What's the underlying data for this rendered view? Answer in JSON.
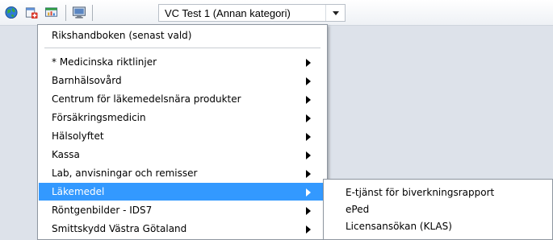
{
  "toolbar": {
    "icons": [
      "globe-icon",
      "document-add-icon",
      "chart-window-icon",
      "monitor-icon"
    ],
    "context_selector": {
      "value": "VC Test 1 (Annan kategori)"
    }
  },
  "menu": {
    "top_item": {
      "label": "Rikshandboken  (senast vald)"
    },
    "items": [
      {
        "label": "* Medicinska riktlinjer",
        "has_submenu": true
      },
      {
        "label": "Barnhälsovård",
        "has_submenu": true
      },
      {
        "label": "Centrum för läkemedelsnära produkter",
        "has_submenu": true
      },
      {
        "label": "Försäkringsmedicin",
        "has_submenu": true
      },
      {
        "label": "Hälsolyftet",
        "has_submenu": true
      },
      {
        "label": "Kassa",
        "has_submenu": true
      },
      {
        "label": "Lab, anvisningar och remisser",
        "has_submenu": true
      },
      {
        "label": "Läkemedel",
        "has_submenu": true,
        "selected": true
      },
      {
        "label": "Röntgenbilder - IDS7",
        "has_submenu": true
      },
      {
        "label": "Smittskydd Västra Götaland",
        "has_submenu": true
      }
    ]
  },
  "submenu": {
    "items": [
      {
        "label": "E-tjänst för biverkningsrapport"
      },
      {
        "label": "ePed"
      },
      {
        "label": "Licensansökan (KLAS)"
      }
    ]
  },
  "colors": {
    "selection": "#3399ff",
    "menu_background": "#ffffff",
    "workspace": "#dde2ea"
  }
}
